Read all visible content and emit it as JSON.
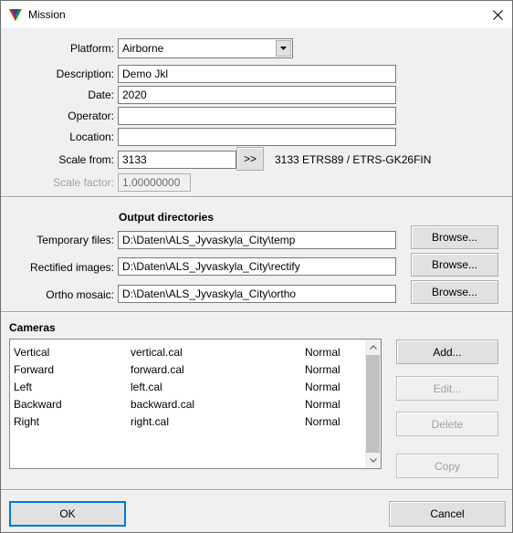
{
  "window": {
    "title": "Mission",
    "icon": "app-triangle-icon",
    "close": "close-icon"
  },
  "form": {
    "platform": {
      "label": "Platform:",
      "value": "Airborne"
    },
    "description": {
      "label": "Description:",
      "value": "Demo Jkl"
    },
    "date": {
      "label": "Date:",
      "value": "2020"
    },
    "operator": {
      "label": "Operator:",
      "value": ""
    },
    "location": {
      "label": "Location:",
      "value": ""
    },
    "scale_from": {
      "label": "Scale from:",
      "value": "3133",
      "button": ">>",
      "info": "3133 ETRS89 / ETRS-GK26FIN"
    },
    "scale_factor": {
      "label": "Scale factor:",
      "value": "1.00000000"
    }
  },
  "output": {
    "heading": "Output directories",
    "temporary": {
      "label": "Temporary files:",
      "value": "D:\\Daten\\ALS_Jyvaskyla_City\\temp",
      "button": "Browse..."
    },
    "rectified": {
      "label": "Rectified images:",
      "value": "D:\\Daten\\ALS_Jyvaskyla_City\\rectify",
      "button": "Browse..."
    },
    "ortho": {
      "label": "Ortho mosaic:",
      "value": "D:\\Daten\\ALS_Jyvaskyla_City\\ortho",
      "button": "Browse..."
    }
  },
  "cameras": {
    "heading": "Cameras",
    "rows": [
      {
        "name": "Vertical",
        "file": "vertical.cal",
        "type": "Normal"
      },
      {
        "name": "Forward",
        "file": "forward.cal",
        "type": "Normal"
      },
      {
        "name": "Left",
        "file": "left.cal",
        "type": "Normal"
      },
      {
        "name": "Backward",
        "file": "backward.cal",
        "type": "Normal"
      },
      {
        "name": "Right",
        "file": "right.cal",
        "type": "Normal"
      }
    ],
    "buttons": {
      "add": "Add...",
      "edit": "Edit...",
      "delete": "Delete",
      "copy": "Copy"
    }
  },
  "footer": {
    "ok": "OK",
    "cancel": "Cancel"
  },
  "colors": {
    "accent": "#0078d7",
    "disabled_text": "#a0a0a0"
  }
}
